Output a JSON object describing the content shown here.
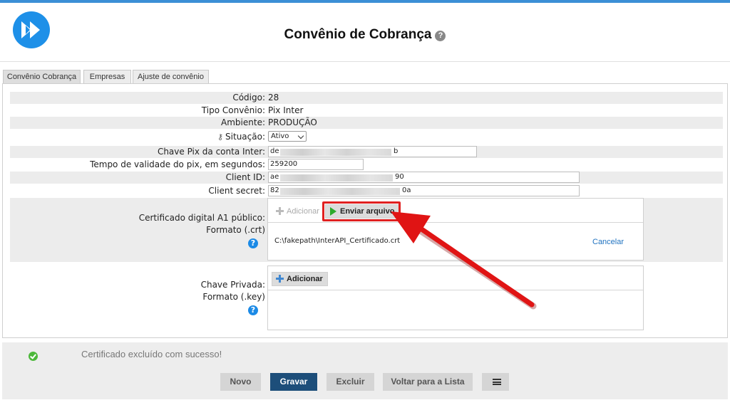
{
  "header": {
    "title": "Convênio de Cobrança",
    "help": "?"
  },
  "tabs": [
    {
      "label": "Convênio Cobrança",
      "active": true
    },
    {
      "label": "Empresas",
      "active": false
    },
    {
      "label": "Ajuste de convênio",
      "active": false
    }
  ],
  "form": {
    "codigo": {
      "label": "Código:",
      "value": "28"
    },
    "tipo": {
      "label": "Tipo Convênio:",
      "value": "Pix Inter"
    },
    "ambiente": {
      "label": "Ambiente:",
      "value": "PRODUÇÃO"
    },
    "situacao": {
      "label": "Situação:",
      "value": "Ativo"
    },
    "chave_pix": {
      "label": "Chave Pix da conta Inter:",
      "value_start": "de",
      "value_end": "b"
    },
    "tempo": {
      "label": "Tempo de validade do pix, em segundos:",
      "value": "259200"
    },
    "client_id": {
      "label": "Client ID:",
      "value_start": "ae",
      "value_end": "90"
    },
    "client_secret": {
      "label": "Client secret:",
      "value_start": "82",
      "value_end": "0a"
    }
  },
  "cert": {
    "label_line1": "Certificado digital A1 público:",
    "label_line2": "Formato (.crt)",
    "help": "?",
    "add_label": "Adicionar",
    "send_label": "Enviar arquivo",
    "file_name": "C:\\fakepath\\InterAPI_Certificado.crt",
    "cancel_label": "Cancelar"
  },
  "key": {
    "label_line1": "Chave Privada:",
    "label_line2": "Formato (.key)",
    "help": "?",
    "add_label": "Adicionar"
  },
  "footer": {
    "message": "Certificado excluído com sucesso!",
    "buttons": {
      "novo": "Novo",
      "gravar": "Gravar",
      "excluir": "Excluir",
      "voltar": "Voltar para a Lista"
    }
  },
  "colors": {
    "accent": "#1b8ae6",
    "primary_button": "#1d4e7a",
    "highlight": "#e02020",
    "success": "#4cb83a"
  }
}
